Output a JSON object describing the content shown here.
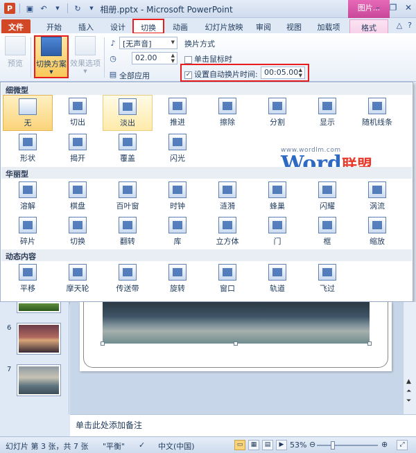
{
  "window": {
    "title": "相册.pptx - Microsoft PowerPoint",
    "context_tab_header": "图片..."
  },
  "tabs": [
    {
      "label": "文件"
    },
    {
      "label": "开始"
    },
    {
      "label": "插入"
    },
    {
      "label": "设计"
    },
    {
      "label": "切换"
    },
    {
      "label": "动画"
    },
    {
      "label": "幻灯片放映"
    },
    {
      "label": "审阅"
    },
    {
      "label": "视图"
    },
    {
      "label": "加载项"
    },
    {
      "label": "格式"
    }
  ],
  "ribbon": {
    "preview_label": "预览",
    "transition_scheme_label": "切换方案",
    "effect_options_label": "效果选项",
    "sound_value": "[无声音]",
    "duration_value": "02.00",
    "apply_all_label": "全部应用",
    "advance_title": "换片方式",
    "on_click_label": "单击鼠标时",
    "auto_advance_label": "设置自动换片时间:",
    "auto_advance_value": "00:05.00",
    "on_click_checked": "",
    "auto_advance_checked": "✓"
  },
  "gallery": {
    "sections": [
      {
        "title": "细微型",
        "items": [
          "无",
          "切出",
          "淡出",
          "推进",
          "擦除",
          "分割",
          "显示",
          "随机线条",
          "形状",
          "揭开",
          "覆盖",
          "闪光"
        ]
      },
      {
        "title": "华丽型",
        "items": [
          "溶解",
          "棋盘",
          "百叶窗",
          "时钟",
          "涟漪",
          "蜂巢",
          "闪耀",
          "涡流",
          "碎片",
          "切换",
          "翻转",
          "库",
          "立方体",
          "门",
          "框",
          "缩放"
        ]
      },
      {
        "title": "动态内容",
        "items": [
          "平移",
          "摩天轮",
          "传送带",
          "旋转",
          "窗口",
          "轨道",
          "飞过"
        ]
      }
    ]
  },
  "watermark": {
    "url": "www.wordlm.com",
    "logo_a": "Word",
    "logo_b": "联盟"
  },
  "slides_pane": {
    "numbers": [
      "6",
      "7"
    ]
  },
  "notes_placeholder": "单击此处添加备注",
  "status": {
    "slide_info": "幻灯片 第 3 张，共 7 张",
    "theme": "\"平衡\"",
    "language": "中文(中国)",
    "zoom": "53%"
  },
  "colors": {
    "accent": "#d24726",
    "highlight": "#e81c1c",
    "selection": "#fbd47a"
  }
}
